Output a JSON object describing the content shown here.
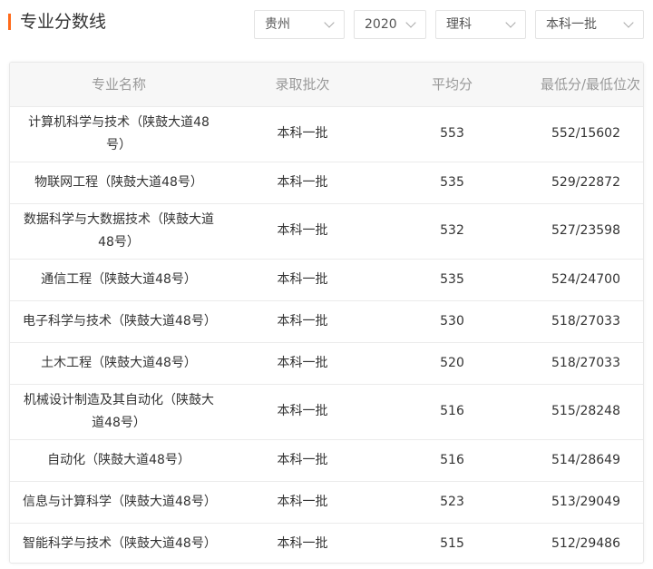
{
  "header": {
    "title": "专业分数线",
    "filters": {
      "province": "贵州",
      "year": "2020",
      "subject": "理科",
      "batch": "本科一批"
    }
  },
  "table": {
    "columns": [
      "专业名称",
      "录取批次",
      "平均分",
      "最低分/最低位次"
    ],
    "rows": [
      {
        "major": "计算机科学与技术（陕鼓大道48号）",
        "batch": "本科一批",
        "avg": "553",
        "min": "552/15602"
      },
      {
        "major": "物联网工程（陕鼓大道48号）",
        "batch": "本科一批",
        "avg": "535",
        "min": "529/22872"
      },
      {
        "major": "数据科学与大数据技术（陕鼓大道48号）",
        "batch": "本科一批",
        "avg": "532",
        "min": "527/23598"
      },
      {
        "major": "通信工程（陕鼓大道48号）",
        "batch": "本科一批",
        "avg": "535",
        "min": "524/24700"
      },
      {
        "major": "电子科学与技术（陕鼓大道48号）",
        "batch": "本科一批",
        "avg": "530",
        "min": "518/27033"
      },
      {
        "major": "土木工程（陕鼓大道48号）",
        "batch": "本科一批",
        "avg": "520",
        "min": "518/27033"
      },
      {
        "major": "机械设计制造及其自动化（陕鼓大道48号）",
        "batch": "本科一批",
        "avg": "516",
        "min": "515/28248"
      },
      {
        "major": "自动化（陕鼓大道48号）",
        "batch": "本科一批",
        "avg": "516",
        "min": "514/28649"
      },
      {
        "major": "信息与计算科学（陕鼓大道48号）",
        "batch": "本科一批",
        "avg": "523",
        "min": "513/29049"
      },
      {
        "major": "智能科学与技术（陕鼓大道48号）",
        "batch": "本科一批",
        "avg": "515",
        "min": "512/29486"
      }
    ]
  }
}
